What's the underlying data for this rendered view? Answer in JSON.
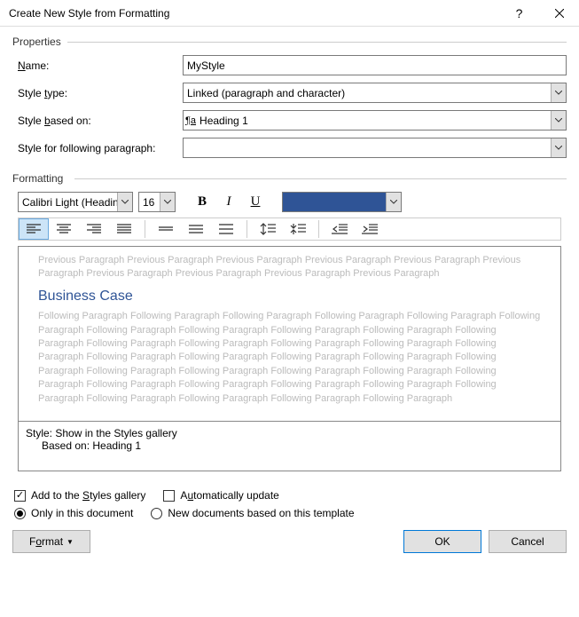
{
  "title": "Create New Style from Formatting",
  "help": "?",
  "properties": {
    "group": "Properties",
    "name_label_pre": "",
    "name_label_ul": "N",
    "name_label_post": "ame:",
    "name_value": "MyStyle",
    "type_label_pre": "Style ",
    "type_label_ul": "t",
    "type_label_post": "ype:",
    "type_value": "Linked (paragraph and character)",
    "based_label_pre": "Style ",
    "based_label_ul": "b",
    "based_label_post": "ased on:",
    "based_value": "Heading 1",
    "following_label_pre": "Style for following paragraph:",
    "following_value": ""
  },
  "formatting": {
    "group": "Formatting",
    "font": "Calibri Light (Headings)",
    "size": "16",
    "bold": "B",
    "italic": "I",
    "underline": "U",
    "color": "#2F5496"
  },
  "preview": {
    "prev": "Previous Paragraph Previous Paragraph Previous Paragraph Previous Paragraph Previous Paragraph Previous Paragraph Previous Paragraph Previous Paragraph Previous Paragraph Previous Paragraph",
    "sample": "Business Case",
    "follow": "Following Paragraph Following Paragraph Following Paragraph Following Paragraph Following Paragraph Following Paragraph Following Paragraph Following Paragraph Following Paragraph Following Paragraph Following Paragraph Following Paragraph Following Paragraph Following Paragraph Following Paragraph Following Paragraph Following Paragraph Following Paragraph Following Paragraph Following Paragraph Following Paragraph Following Paragraph Following Paragraph Following Paragraph Following Paragraph Following Paragraph Following Paragraph Following Paragraph Following Paragraph Following Paragraph Following Paragraph Following Paragraph Following Paragraph Following Paragraph Following Paragraph"
  },
  "description": {
    "line1": "Style: Show in the Styles gallery",
    "line2": "Based on: Heading 1"
  },
  "options": {
    "add_gallery_pre": "Add to the ",
    "add_gallery_ul": "S",
    "add_gallery_post": "tyles gallery",
    "auto_update_pre": "A",
    "auto_update_ul": "u",
    "auto_update_post": "tomatically update",
    "only_doc": "Only in this document",
    "new_docs": "New documents based on this template"
  },
  "buttons": {
    "format": "Format",
    "ok": "OK",
    "cancel": "Cancel"
  }
}
